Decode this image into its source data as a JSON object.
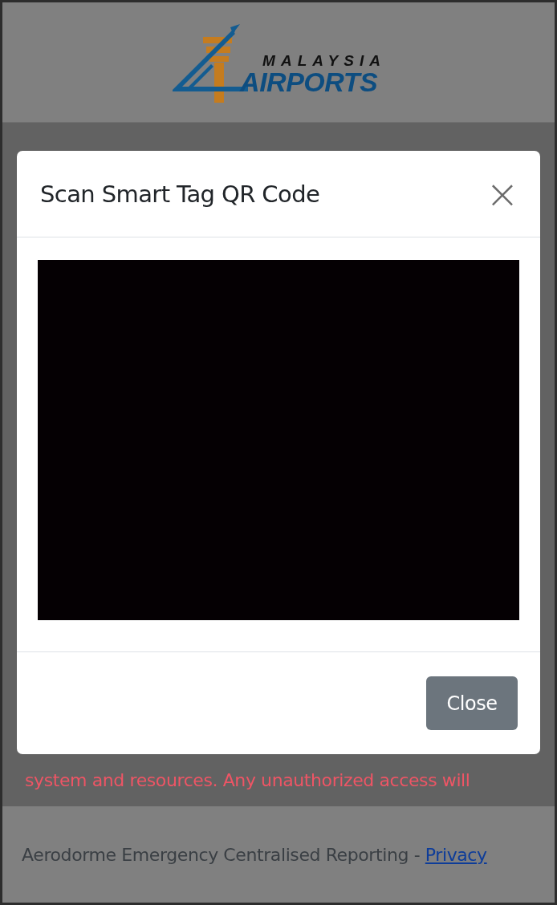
{
  "header": {
    "logo": {
      "line_1": "MALAYSIA",
      "line_2": "AIRPORTS"
    }
  },
  "notice": "system and resources. Any unauthorized access will",
  "footer": {
    "text": "Aerodorme Emergency Centralised Reporting - ",
    "link": "Privacy"
  },
  "dialog": {
    "title": "Scan Smart Tag QR Code",
    "close_icon": "×",
    "camera_view": {
      "kind": "camera"
    },
    "buttons": [
      "Close"
    ]
  }
}
